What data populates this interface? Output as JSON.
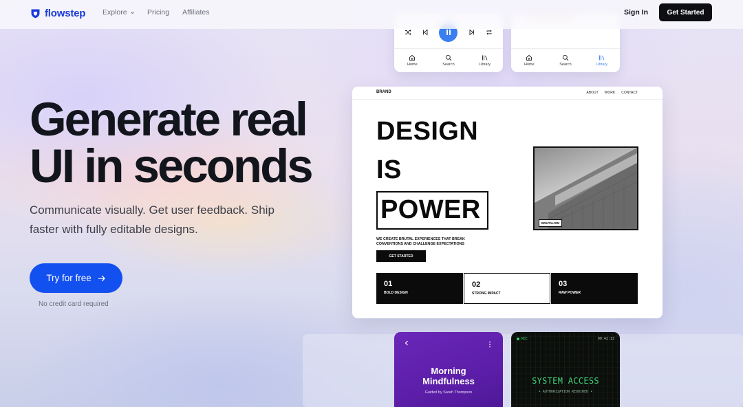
{
  "nav": {
    "brand": "flowstep",
    "explore": "Explore",
    "pricing": "Pricing",
    "affiliates": "Affiliates",
    "sign_in": "Sign In",
    "get_started": "Get Started"
  },
  "hero": {
    "headline_line1": "Generate real",
    "headline_line2": "UI in seconds",
    "subtitle_line1": "Communicate visually. Get user feedback. Ship",
    "subtitle_line2": "faster with fully editable designs.",
    "cta_label": "Try for free",
    "cta_note": "No credit card required"
  },
  "music_cards": [
    {
      "tabs": [
        {
          "icon": "home-icon",
          "label": "Home"
        },
        {
          "icon": "search-icon",
          "label": "Search"
        },
        {
          "icon": "library-icon",
          "label": "Library"
        }
      ],
      "active_tab": "Home"
    },
    {
      "tabs": [
        {
          "icon": "home-icon",
          "label": "Home"
        },
        {
          "icon": "search-icon",
          "label": "Search"
        },
        {
          "icon": "library-icon",
          "label": "Library"
        }
      ],
      "active_tab": "Library"
    }
  ],
  "brutal_site": {
    "brand": "BRAND",
    "links": [
      "ABOUT",
      "WORK",
      "CONTACT"
    ],
    "word1": "DESIGN",
    "word2": "IS",
    "word3": "POWER",
    "tagline_line1": "WE CREATE BRUTAL EXPERIENCES THAT BREAK",
    "tagline_line2": "CONVENTIONS AND CHALLENGE EXPECTATIONS",
    "cta": "GET STARTED",
    "photo_label": "BRUTALISM",
    "features": [
      {
        "num": "01",
        "title": "BOLD DESIGN"
      },
      {
        "num": "02",
        "title": "STRONG IMPACT"
      },
      {
        "num": "03",
        "title": "RAW POWER"
      }
    ]
  },
  "mindfulness_card": {
    "title_line1": "Morning",
    "title_line2": "Mindfulness",
    "subtitle": "Guided by Sarah Thompson"
  },
  "system_card": {
    "rec": "REC",
    "time": "00:42:13",
    "title": "SYSTEM ACCESS",
    "subtitle": "AUTHORIZATION REQUIRED"
  },
  "colors": {
    "brand_blue": "#1a3bd8",
    "cta_blue": "#1350f0",
    "player_blue": "#3a7ef0",
    "mindfulness_purple": "#5c1ea8",
    "terminal_green": "#3fd47a"
  }
}
